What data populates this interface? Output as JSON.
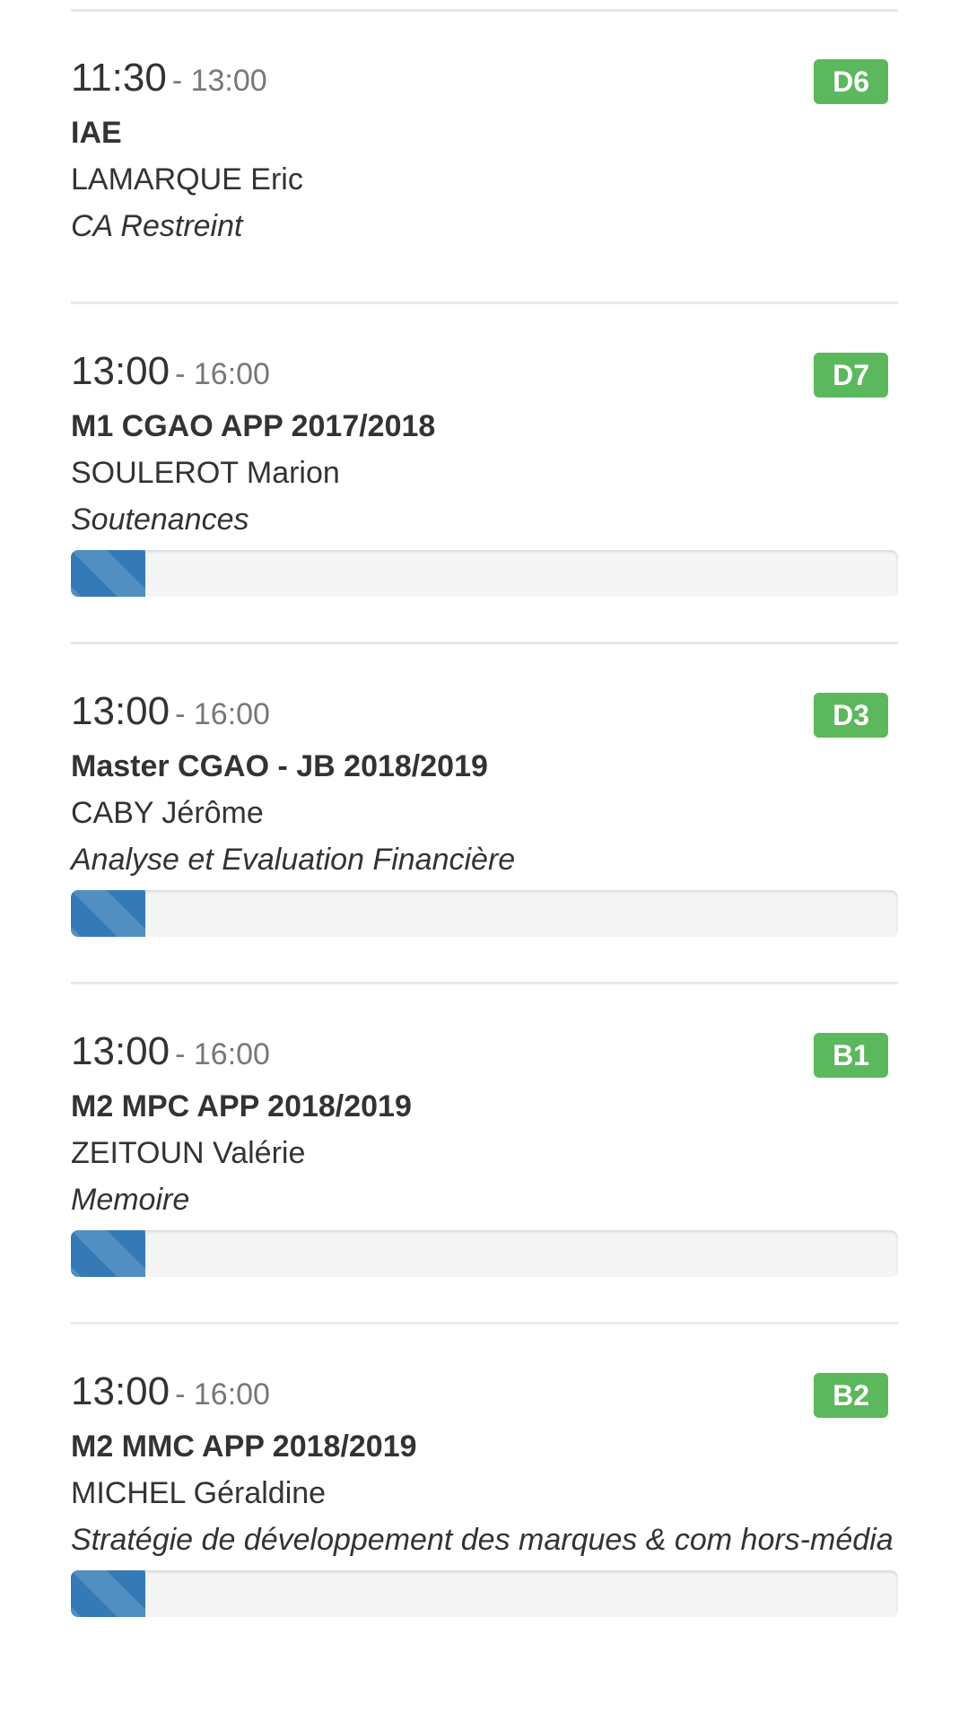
{
  "events": [
    {
      "start": "11:30",
      "end": "- 13:00",
      "room": "D6",
      "course": "IAE",
      "teacher": "LAMARQUE Eric",
      "subject": "CA Restreint",
      "progress": null
    },
    {
      "start": "13:00",
      "end": "- 16:00",
      "room": "D7",
      "course": "M1 CGAO APP 2017/2018",
      "teacher": "SOULEROT Marion",
      "subject": "Soutenances",
      "progress": 0.09
    },
    {
      "start": "13:00",
      "end": "- 16:00",
      "room": "D3",
      "course": "Master CGAO - JB 2018/2019",
      "teacher": "CABY Jérôme",
      "subject": "Analyse et Evaluation Financière",
      "progress": 0.09
    },
    {
      "start": "13:00",
      "end": "- 16:00",
      "room": "B1",
      "course": "M2 MPC APP 2018/2019",
      "teacher": "ZEITOUN Valérie",
      "subject": "Memoire",
      "progress": 0.09
    },
    {
      "start": "13:00",
      "end": "- 16:00",
      "room": "B2",
      "course": "M2 MMC APP 2018/2019",
      "teacher": "MICHEL Géraldine",
      "subject": "Stratégie de développement des marques & com hors-média",
      "progress": 0.09
    }
  ],
  "colors": {
    "badge": "#5cb85c",
    "progress": "#337ab7"
  }
}
